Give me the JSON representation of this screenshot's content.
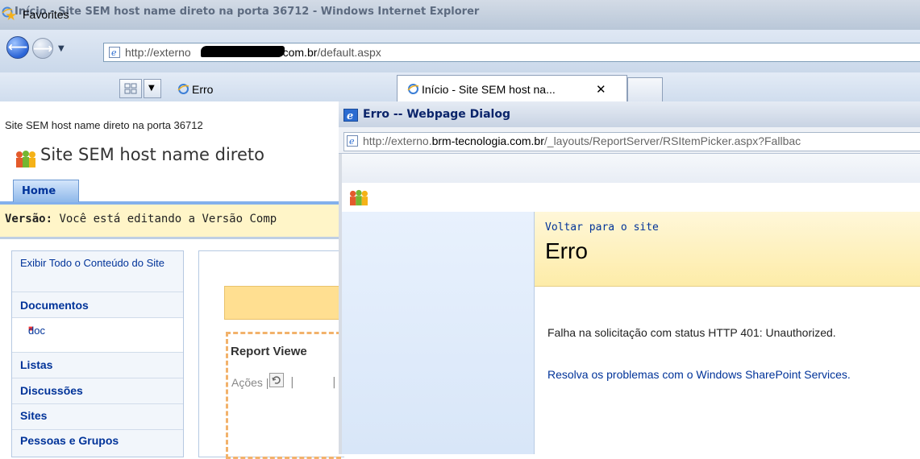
{
  "window": {
    "title": "Início - Site SEM host name direto na porta 36712 - Windows Internet Explorer"
  },
  "address": {
    "url_prefix": "http://externo",
    "url_domain": ".com.br",
    "url_suffix": "/default.aspx"
  },
  "favorites": {
    "label": "Favorites"
  },
  "tabs": [
    {
      "label": "Erro"
    },
    {
      "label": "Início - Site SEM host na...",
      "close": "✕"
    }
  ],
  "sharepoint": {
    "breadcrumb": "Site SEM host name direto na porta 36712",
    "title": "Site SEM host name direto",
    "home_tab": "Home",
    "versao_label": "Versão:",
    "versao_text": "Você está editando a Versão Comp",
    "quicklaunch": {
      "view_all": "Exibir Todo o Conteúdo do Site",
      "documentos": "Documentos",
      "doc_item": "doc",
      "listas": "Listas",
      "discussoes": "Discussões",
      "sites": "Sites",
      "pessoas": "Pessoas e Grupos"
    },
    "report_viewer_title": "Report Viewe",
    "toolbar_actions": "Ações |"
  },
  "dialog": {
    "title": "Erro -- Webpage Dialog",
    "url_prefix": "http://externo.",
    "url_domain": "brm-tecnologia.com.br",
    "url_suffix": "/_layouts/ReportServer/RSItemPicker.aspx?Fallbac",
    "back_link": "Voltar para o site",
    "heading": "Erro",
    "message": "Falha na solicitação com status HTTP 401: Unauthorized.",
    "help_link": "Resolva os problemas com o Windows SharePoint Services."
  }
}
